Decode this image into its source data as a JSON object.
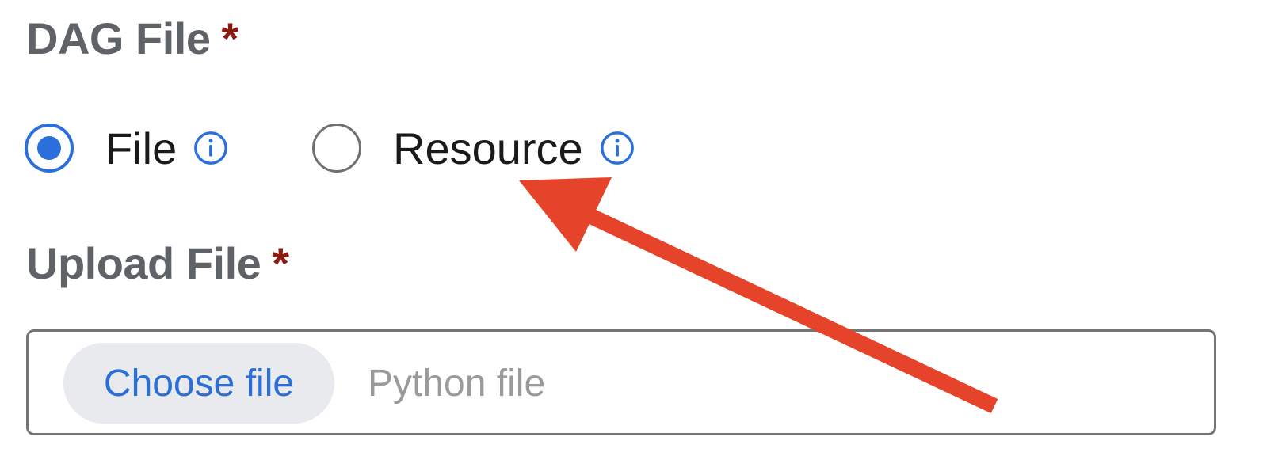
{
  "dag_file": {
    "label": "DAG File",
    "required_marker": "*",
    "options": [
      {
        "label": "File",
        "selected": true,
        "info_icon": "info-icon"
      },
      {
        "label": "Resource",
        "selected": false,
        "info_icon": "info-icon"
      }
    ]
  },
  "upload_file": {
    "label": "Upload File",
    "required_marker": "*",
    "choose_button_label": "Choose file",
    "placeholder": "Python file"
  },
  "annotation": {
    "arrow_color": "#e5432a",
    "points_to": "Resource"
  },
  "colors": {
    "accent": "#2a6fdb",
    "required": "#8b1a10",
    "label": "#5f6368"
  }
}
